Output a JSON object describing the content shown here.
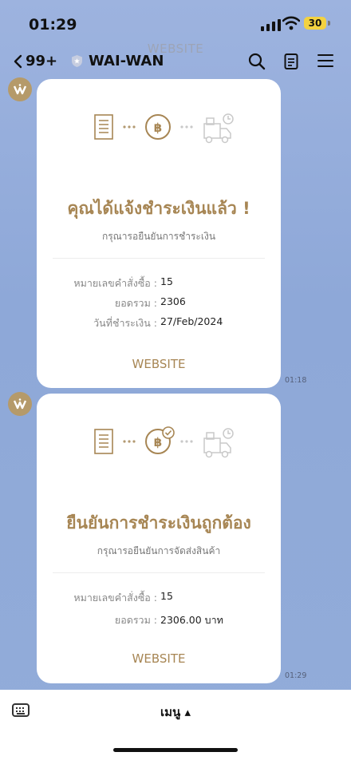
{
  "status_bar": {
    "time": "01:29",
    "battery": "30"
  },
  "background_text": "WEBSITE",
  "header": {
    "back_count": "99+",
    "chat_name": "WAI-WAN"
  },
  "messages": [
    {
      "title": "คุณได้แจ้งชำระเงินแล้ว !",
      "subtitle": "กรุณารอยืนยันการชำระเงิน",
      "rows": [
        {
          "label": "หมายเลขคำสั่งซื้อ :",
          "value": "15"
        },
        {
          "label": "ยอดรวม :",
          "value": "2306"
        },
        {
          "label": "วันที่ชำระเงิน :",
          "value": "27/Feb/2024"
        }
      ],
      "link": "WEBSITE",
      "time": "01:18"
    },
    {
      "title": "ยืนยันการชำระเงินถูกต้อง",
      "subtitle": "กรุณารอยืนยันการจัดส่งสินค้า",
      "rows": [
        {
          "label": "หมายเลขคำสั่งซื้อ :",
          "value": "15"
        },
        {
          "label": "ยอดรวม :",
          "value": "2306.00 บาท"
        }
      ],
      "link": "WEBSITE",
      "time": "01:29"
    }
  ],
  "bottom_bar": {
    "menu_label": "เมนู ▴"
  },
  "colors": {
    "accent_gold": "#a78654",
    "chat_background": "#8fa9d8",
    "battery_yellow": "#f3d240"
  },
  "icons": [
    "signal-icon",
    "wifi-icon",
    "battery-icon",
    "back-chevron-icon",
    "shield-badge-icon",
    "search-icon",
    "notes-icon",
    "hamburger-menu-icon",
    "brand-avatar-icon",
    "invoice-icon",
    "baht-coin-icon",
    "delivery-truck-icon",
    "check-badge-icon",
    "keyboard-icon"
  ]
}
